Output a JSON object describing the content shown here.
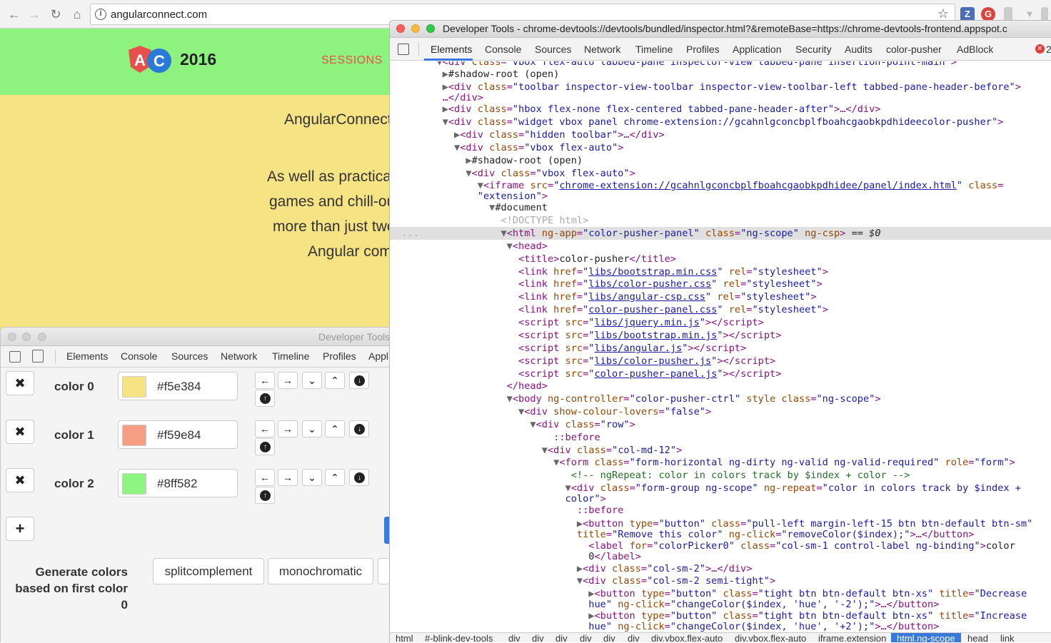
{
  "browser": {
    "url": "angularconnect.com",
    "colors": {
      "accent_red": "#e8514b",
      "z_ext": "#4a6db8"
    }
  },
  "page": {
    "logo_text": "AC",
    "year": "2016",
    "nav": {
      "sessions": "SESSIONS"
    },
    "lines": [
      "AngularConnect",
      "As well as practical,",
      "games and chill-ou",
      "more than just two",
      "Angular comm"
    ],
    "colors": {
      "header_bg": "#8ef27f",
      "body_bg": "#f5e384"
    }
  },
  "float_devtools": {
    "title": "Developer Tools",
    "tabs": [
      "Elements",
      "Console",
      "Sources",
      "Network",
      "Timeline",
      "Profiles",
      "Appl"
    ],
    "colors": [
      {
        "label": "color 0",
        "value": "#f5e384"
      },
      {
        "label": "color 1",
        "value": "#f59e84"
      },
      {
        "label": "color 2",
        "value": "#8ff582"
      }
    ],
    "remove_glyph": "✖",
    "add_glyph": "+",
    "generate_label": "Generate colors based on first color 0",
    "generate_buttons": [
      "splitcomplement",
      "monochromatic"
    ]
  },
  "devtools": {
    "title": "Developer Tools - chrome-devtools://devtools/bundled/inspector.html?&remoteBase=https://chrome-devtools-frontend.appspot.c",
    "tabs": [
      "Elements",
      "Console",
      "Sources",
      "Network",
      "Timeline",
      "Profiles",
      "Application",
      "Security",
      "Audits",
      "color-pusher",
      "AdBlock"
    ],
    "error_count": "2",
    "breadcrumbs": [
      "html",
      "#-blink-dev-tools",
      "div",
      "div",
      "div",
      "div",
      "div",
      "div",
      "div.vbox.flex-auto",
      "div.vbox.flex-auto",
      "iframe.extension",
      "html.ng-scope",
      "head",
      "link"
    ],
    "selected_crumb": "html.ng-scope"
  }
}
